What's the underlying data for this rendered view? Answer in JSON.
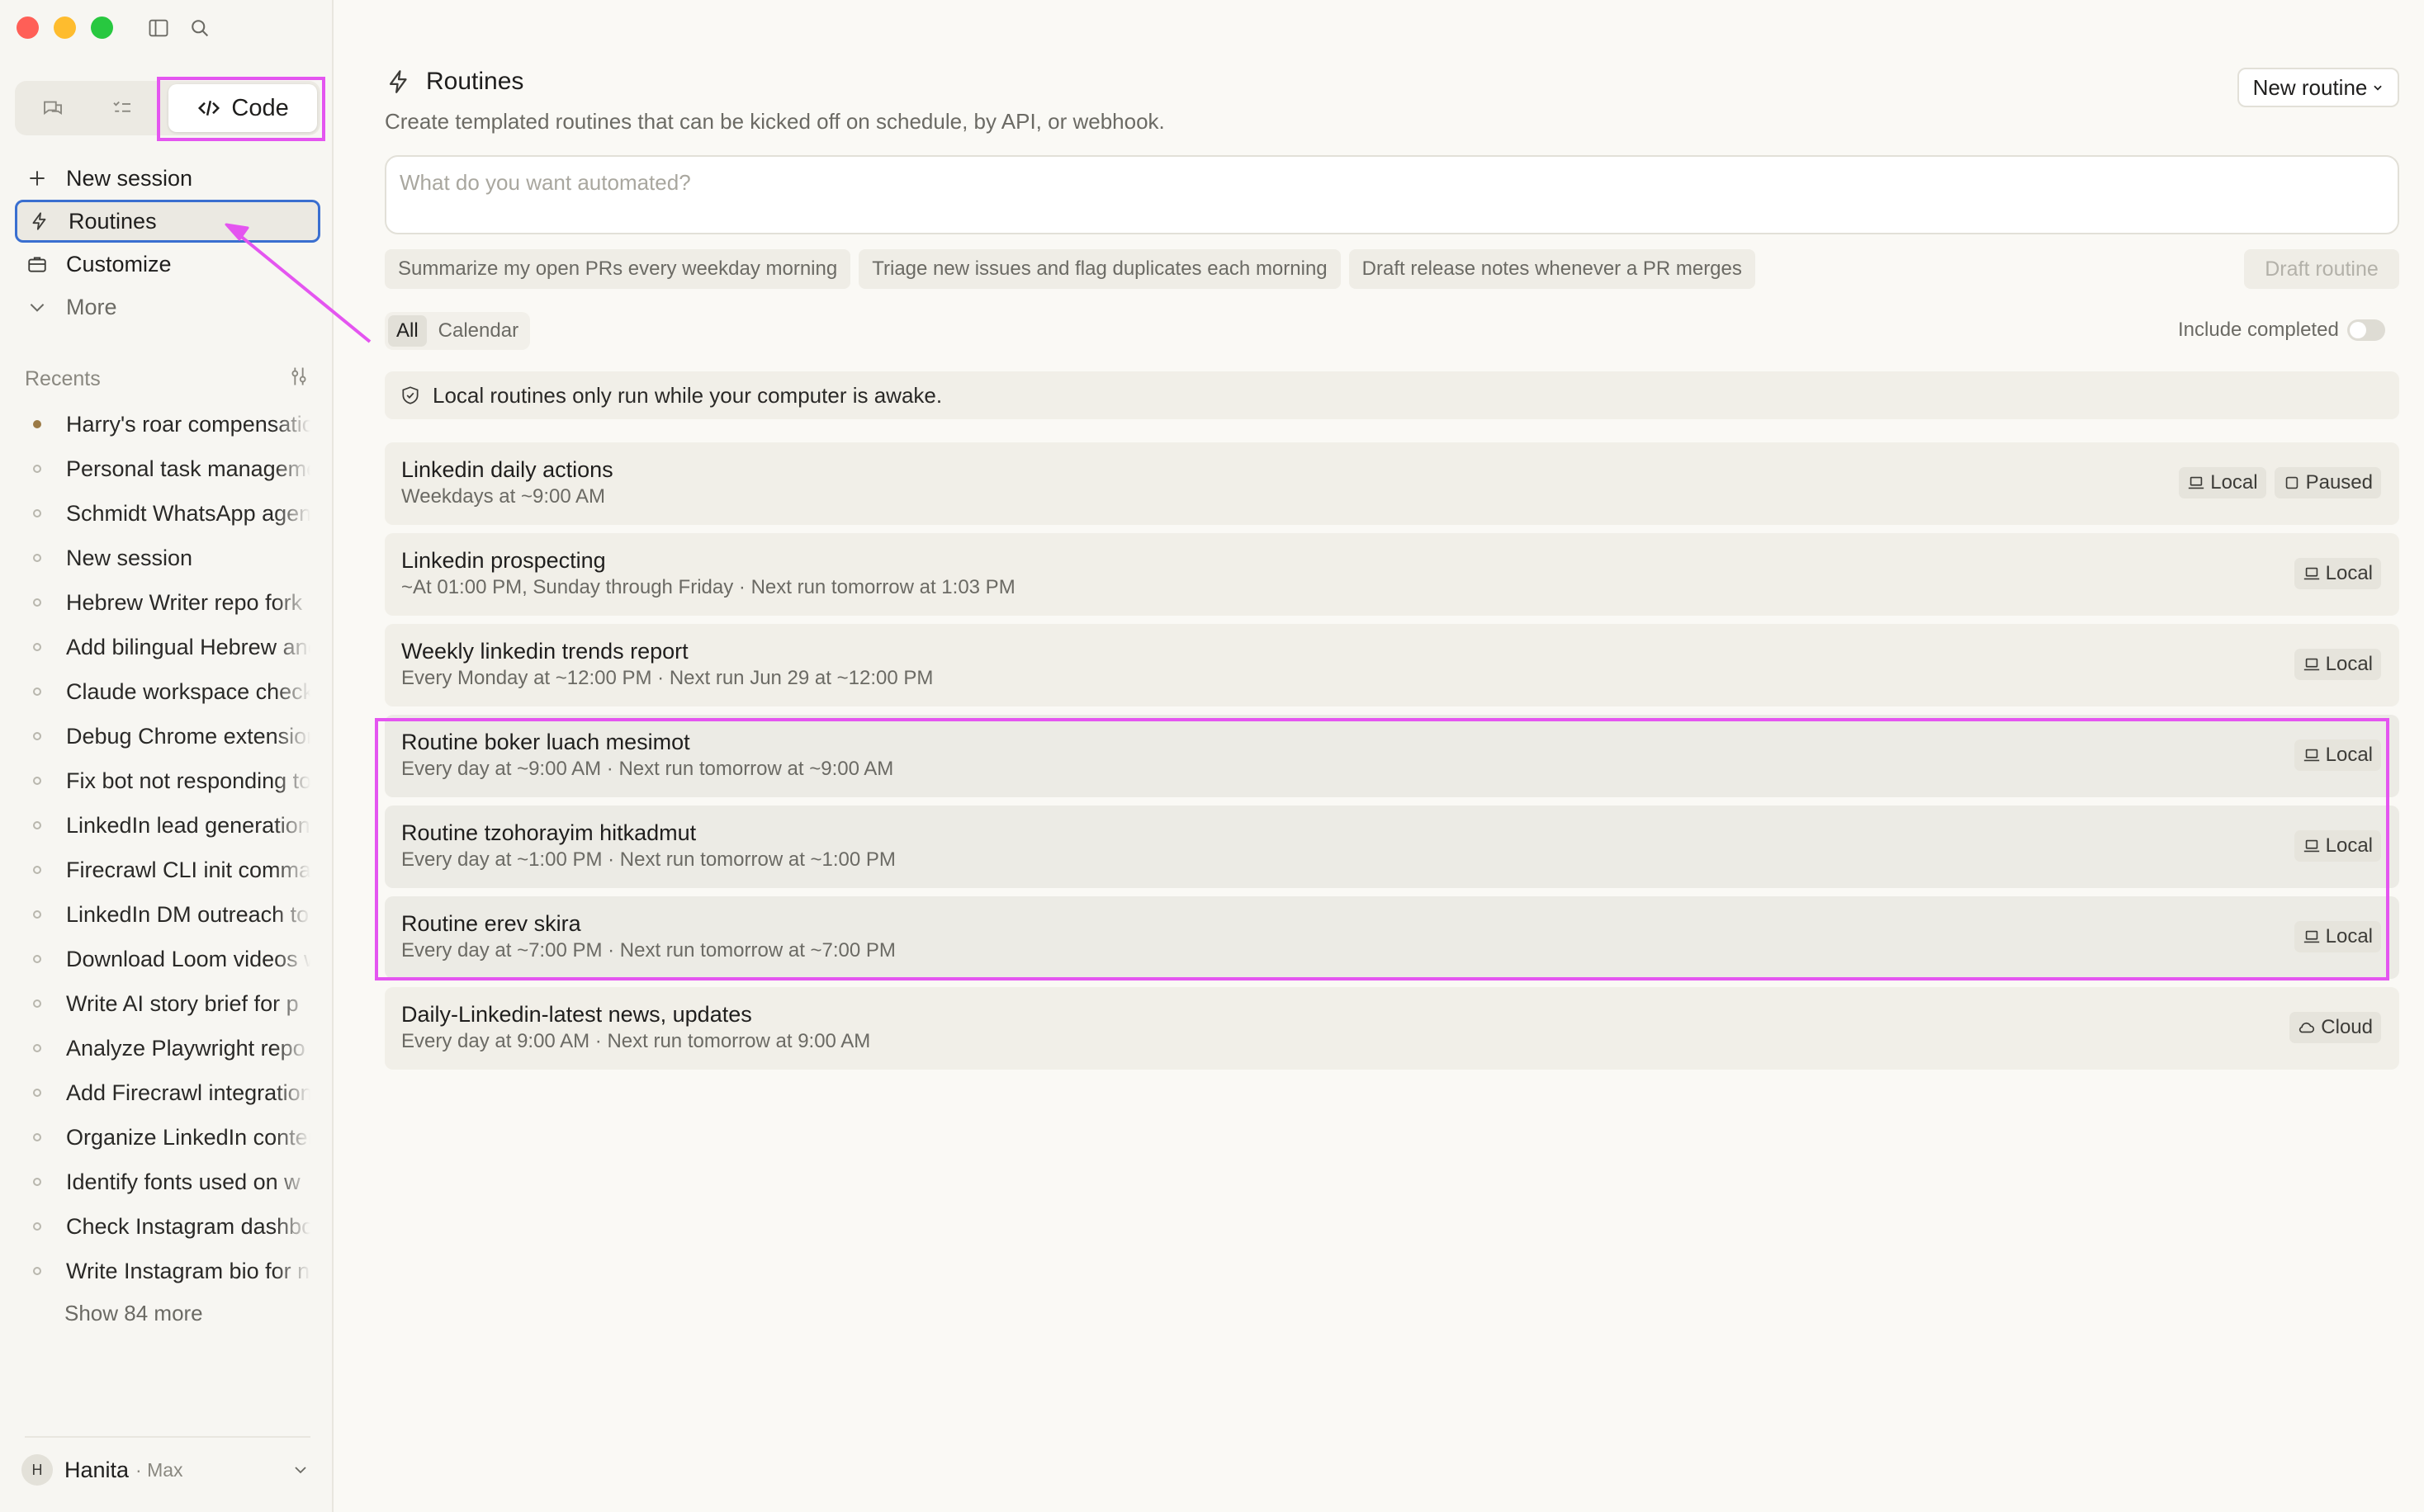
{
  "sidebar": {
    "modes": [
      "chat",
      "tasks",
      "Code"
    ],
    "nav": [
      {
        "label": "New session",
        "icon": "plus-icon"
      },
      {
        "label": "Routines",
        "icon": "bolt-icon"
      },
      {
        "label": "Customize",
        "icon": "briefcase-icon"
      },
      {
        "label": "More",
        "icon": "chevron-down-icon"
      }
    ],
    "recents_label": "Recents",
    "recents": [
      "Harry's roar compensation",
      "Personal task management",
      "Schmidt WhatsApp agent",
      "New session",
      "Hebrew Writer repo fork",
      "Add bilingual Hebrew and",
      "Claude workspace check",
      "Debug Chrome extension",
      "Fix bot not responding to",
      "LinkedIn lead generation",
      "Firecrawl CLI init command",
      "LinkedIn DM outreach to",
      "Download Loom videos w",
      "Write AI story brief for p",
      "Analyze Playwright repo",
      "Add Firecrawl integration",
      "Organize LinkedIn content",
      "Identify fonts used on w",
      "Check Instagram dashbo",
      "Write Instagram bio for n"
    ],
    "show_more": "Show 84 more",
    "profile": {
      "initial": "H",
      "name": "Hanita",
      "plan": "· Max"
    }
  },
  "main": {
    "title": "Routines",
    "subtitle": "Create templated routines that can be kicked off on schedule, by API, or webhook.",
    "new_routine": "New routine",
    "prompt_placeholder": "What do you want automated?",
    "suggestions": [
      "Summarize my open PRs every weekday morning",
      "Triage new issues and flag duplicates each morning",
      "Draft release notes whenever a PR merges"
    ],
    "draft_routine": "Draft routine",
    "tabs": [
      "All",
      "Calendar"
    ],
    "include_completed": "Include completed",
    "notice": "Local routines only run while your computer is awake.",
    "routines": [
      {
        "name": "Linkedin daily actions",
        "schedule": "Weekdays at ~9:00 AM",
        "badges": [
          {
            "label": "Local",
            "icon": "laptop-icon"
          },
          {
            "label": "Paused",
            "icon": "square-icon"
          }
        ]
      },
      {
        "name": "Linkedin prospecting",
        "schedule": "~At 01:00 PM, Sunday through Friday · Next run tomorrow at 1:03 PM",
        "badges": [
          {
            "label": "Local",
            "icon": "laptop-icon"
          }
        ]
      },
      {
        "name": "Weekly linkedin trends report",
        "schedule": "Every Monday at ~12:00 PM · Next run Jun 29 at ~12:00 PM",
        "badges": [
          {
            "label": "Local",
            "icon": "laptop-icon"
          }
        ]
      },
      {
        "name": "Routine boker luach mesimot",
        "schedule": "Every day at ~9:00 AM · Next run tomorrow at ~9:00 AM",
        "badges": [
          {
            "label": "Local",
            "icon": "laptop-icon"
          }
        ]
      },
      {
        "name": "Routine tzohorayim hitkadmut",
        "schedule": "Every day at ~1:00 PM · Next run tomorrow at ~1:00 PM",
        "badges": [
          {
            "label": "Local",
            "icon": "laptop-icon"
          }
        ]
      },
      {
        "name": "Routine erev skira",
        "schedule": "Every day at ~7:00 PM · Next run tomorrow at ~7:00 PM",
        "badges": [
          {
            "label": "Local",
            "icon": "laptop-icon"
          }
        ]
      },
      {
        "name": "Daily-Linkedin-latest news, updates",
        "schedule": "Every day at 9:00 AM · Next run tomorrow at 9:00 AM",
        "badges": [
          {
            "label": "Cloud",
            "icon": "cloud-icon"
          }
        ]
      }
    ]
  },
  "colors": {
    "highlight": "#e455f0",
    "active_border": "#3a6fd0"
  }
}
